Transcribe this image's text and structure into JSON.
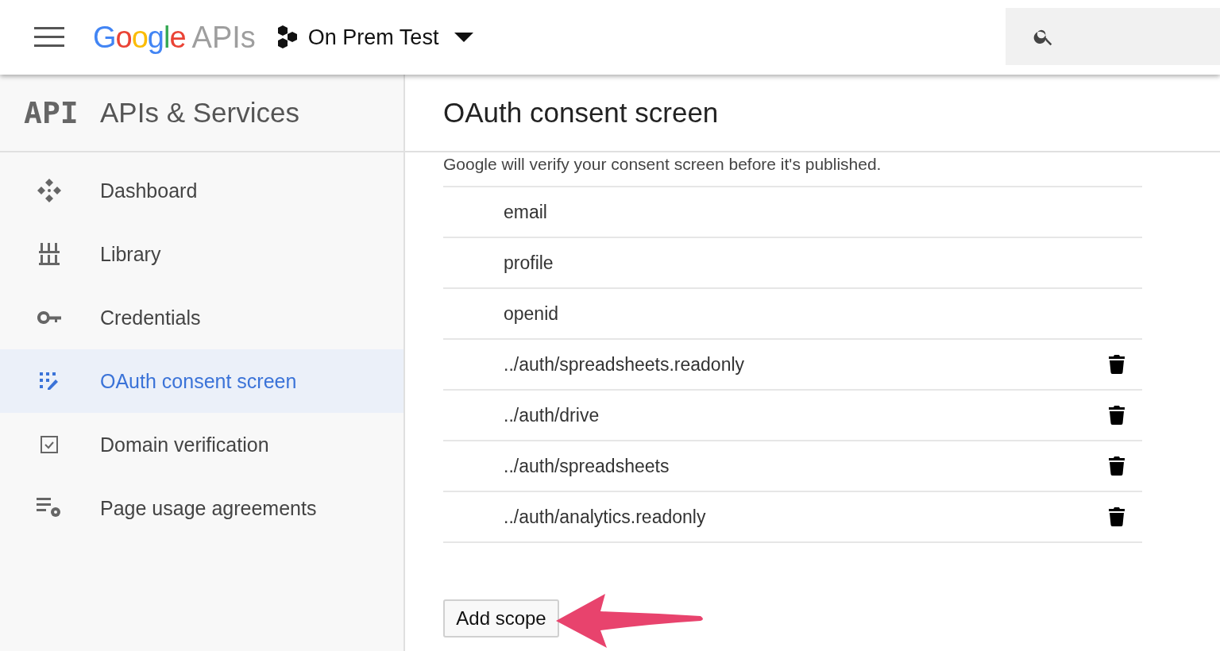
{
  "header": {
    "logo_google": "Google",
    "logo_apis": "APIs",
    "project": "On Prem Test"
  },
  "sidebar": {
    "title_icon": "API",
    "title": "APIs & Services",
    "items": [
      {
        "label": "Dashboard",
        "selected": false
      },
      {
        "label": "Library",
        "selected": false
      },
      {
        "label": "Credentials",
        "selected": false
      },
      {
        "label": "OAuth consent screen",
        "selected": true
      },
      {
        "label": "Domain verification",
        "selected": false
      },
      {
        "label": "Page usage agreements",
        "selected": false
      }
    ]
  },
  "main": {
    "title": "OAuth consent screen",
    "note": "Google will verify your consent screen before it's published.",
    "scopes": [
      {
        "name": "email",
        "deletable": false
      },
      {
        "name": "profile",
        "deletable": false
      },
      {
        "name": "openid",
        "deletable": false
      },
      {
        "name": "../auth/spreadsheets.readonly",
        "deletable": true
      },
      {
        "name": "../auth/drive",
        "deletable": true
      },
      {
        "name": "../auth/spreadsheets",
        "deletable": true
      },
      {
        "name": "../auth/analytics.readonly",
        "deletable": true
      }
    ],
    "add_button": "Add scope"
  }
}
